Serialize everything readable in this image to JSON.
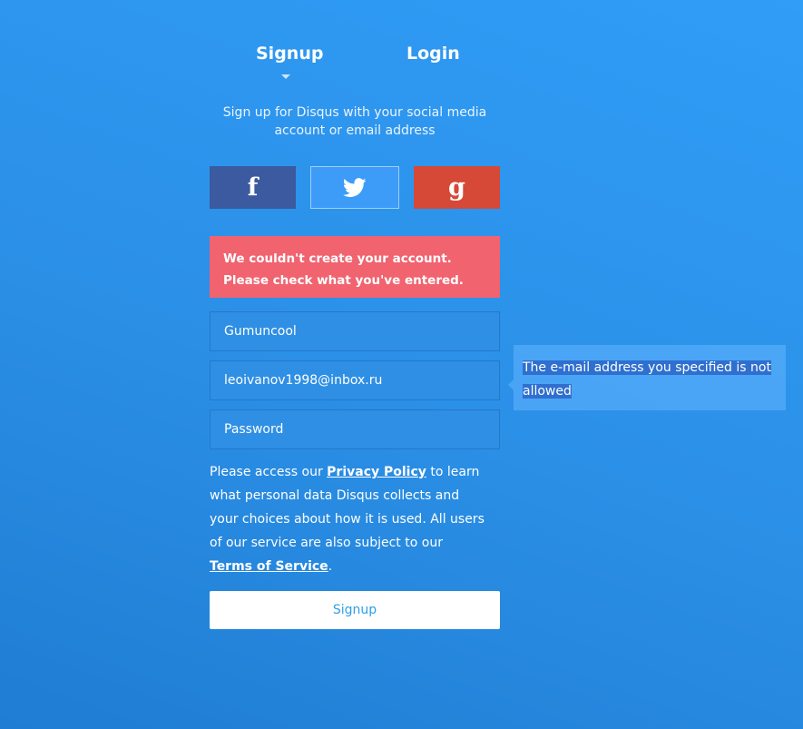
{
  "tabs": {
    "signup": "Signup",
    "login": "Login"
  },
  "subtitle": "Sign up for Disqus with your social media account or email address",
  "social": {
    "facebook_glyph": "f",
    "google_glyph": "g",
    "facebook_color": "#3b5aa0",
    "twitter_color": "#3c9cf7",
    "google_color": "#d64937"
  },
  "error_message": "We couldn't create your account. Please check what you've entered.",
  "form": {
    "username_value": "Gumuncool",
    "email_value": "leoivanov1998@inbox.ru",
    "password_placeholder": "Password"
  },
  "tooltip": {
    "message": "The e-mail address you specified is not allowed"
  },
  "privacy": {
    "text_1": "Please access our ",
    "privacy_link": "Privacy Policy",
    "text_2": " to learn what personal data Disqus collects and your choices about how it is used. All users of our service are also subject to our ",
    "terms_link": "Terms of Service",
    "text_3": "."
  },
  "submit_label": "Signup",
  "colors": {
    "error_bg": "#f0636f",
    "submit_text": "#2e9fe6"
  }
}
